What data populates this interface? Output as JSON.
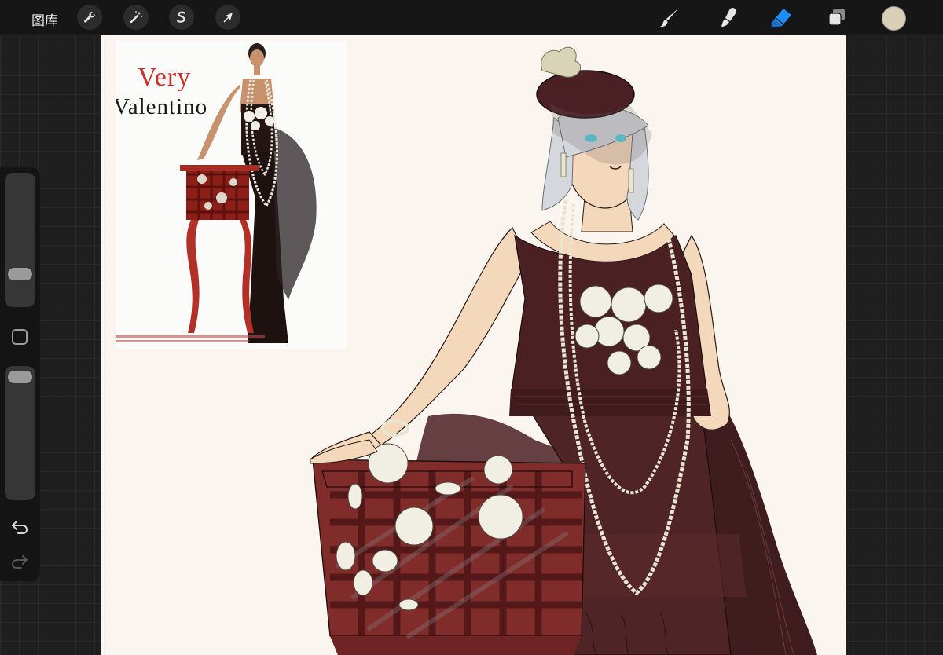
{
  "topbar": {
    "gallery_label": "图库",
    "left_tools": [
      {
        "name": "actions",
        "icon": "wrench-icon"
      },
      {
        "name": "adjustments",
        "icon": "magic-wand-icon"
      },
      {
        "name": "selection",
        "icon": "selection-s-icon"
      },
      {
        "name": "transform",
        "icon": "arrow-cursor-icon"
      }
    ],
    "right_tools": [
      {
        "name": "brush",
        "icon": "brush-icon",
        "active": false
      },
      {
        "name": "smudge",
        "icon": "smudge-icon",
        "active": false
      },
      {
        "name": "eraser",
        "icon": "eraser-icon",
        "active": true
      },
      {
        "name": "layers",
        "icon": "layers-icon",
        "active": false
      }
    ],
    "current_color": "#d8cfb6",
    "active_tool_color": "#1e8cff"
  },
  "sidebar": {
    "brush_size": 0.33,
    "brush_opacity": 0.92,
    "modify_icon": "square-icon",
    "undo_icon": "undo-icon",
    "redo_icon": "redo-icon"
  },
  "reference": {
    "title_line1": "Very",
    "title_line2": "Valentino"
  },
  "colors": {
    "canvas": "#faf6ef",
    "dress": "#4a2022",
    "table": "#8a2d2b",
    "skin": "#f4d8bc",
    "hair": "#d4d7dc",
    "pearls": "#e8e6d2",
    "roses": "#f1efe4"
  }
}
